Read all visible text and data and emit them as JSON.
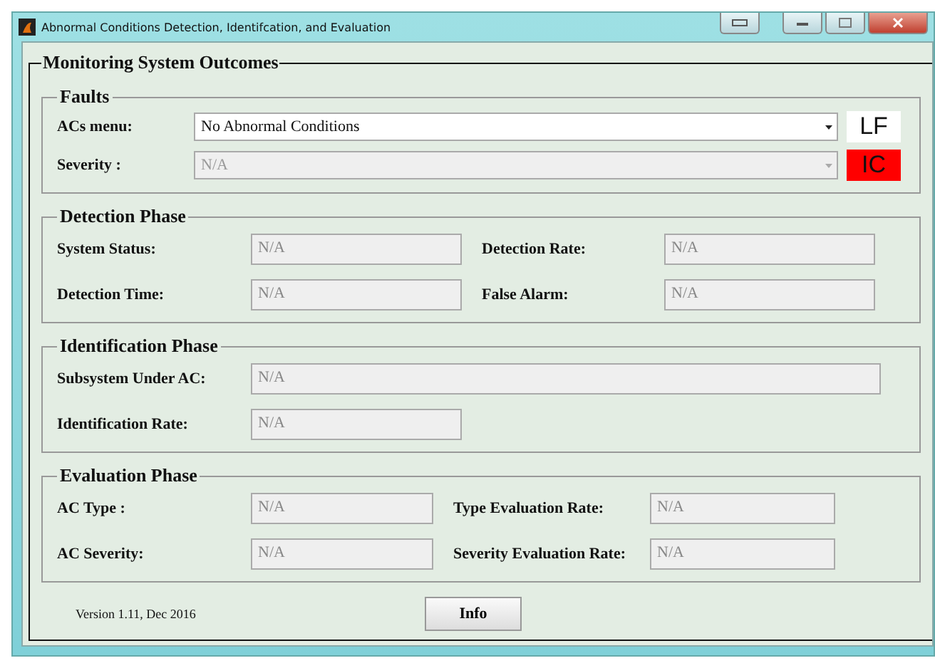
{
  "window": {
    "title": "Abnormal Conditions Detection, Identifcation, and Evaluation"
  },
  "panel": {
    "title": "Monitoring System Outcomes"
  },
  "faults": {
    "title": "Faults",
    "acs_menu": {
      "label": "ACs menu:",
      "value": "No Abnormal Conditions",
      "disabled": false
    },
    "severity": {
      "label": "Severity :",
      "value": "N/A",
      "disabled": true
    },
    "indicators": [
      {
        "label": "LF",
        "color": "#ffffff"
      },
      {
        "label": "IC",
        "color": "#ff0000"
      }
    ]
  },
  "detection": {
    "title": "Detection Phase",
    "fields": [
      {
        "label": "System Status:",
        "value": "N/A"
      },
      {
        "label": "Detection Rate:",
        "value": "N/A"
      },
      {
        "label": "Detection Time:",
        "value": "N/A"
      },
      {
        "label": "False Alarm:",
        "value": "N/A"
      }
    ]
  },
  "identification": {
    "title": "Identification Phase",
    "fields": [
      {
        "label": "Subsystem Under AC:",
        "value": "N/A",
        "kind": "wide"
      },
      {
        "label": "Identification Rate:",
        "value": "N/A",
        "kind": "short"
      }
    ]
  },
  "evaluation": {
    "title": "Evaluation Phase",
    "fields": [
      {
        "label": "AC Type :",
        "value": "N/A"
      },
      {
        "label": "Type Evaluation Rate:",
        "value": "N/A"
      },
      {
        "label": "AC Severity:",
        "value": "N/A"
      },
      {
        "label": "Severity Evaluation Rate:",
        "value": "N/A"
      }
    ]
  },
  "footer": {
    "version": "Version 1.11, Dec 2016",
    "button": "Info"
  }
}
